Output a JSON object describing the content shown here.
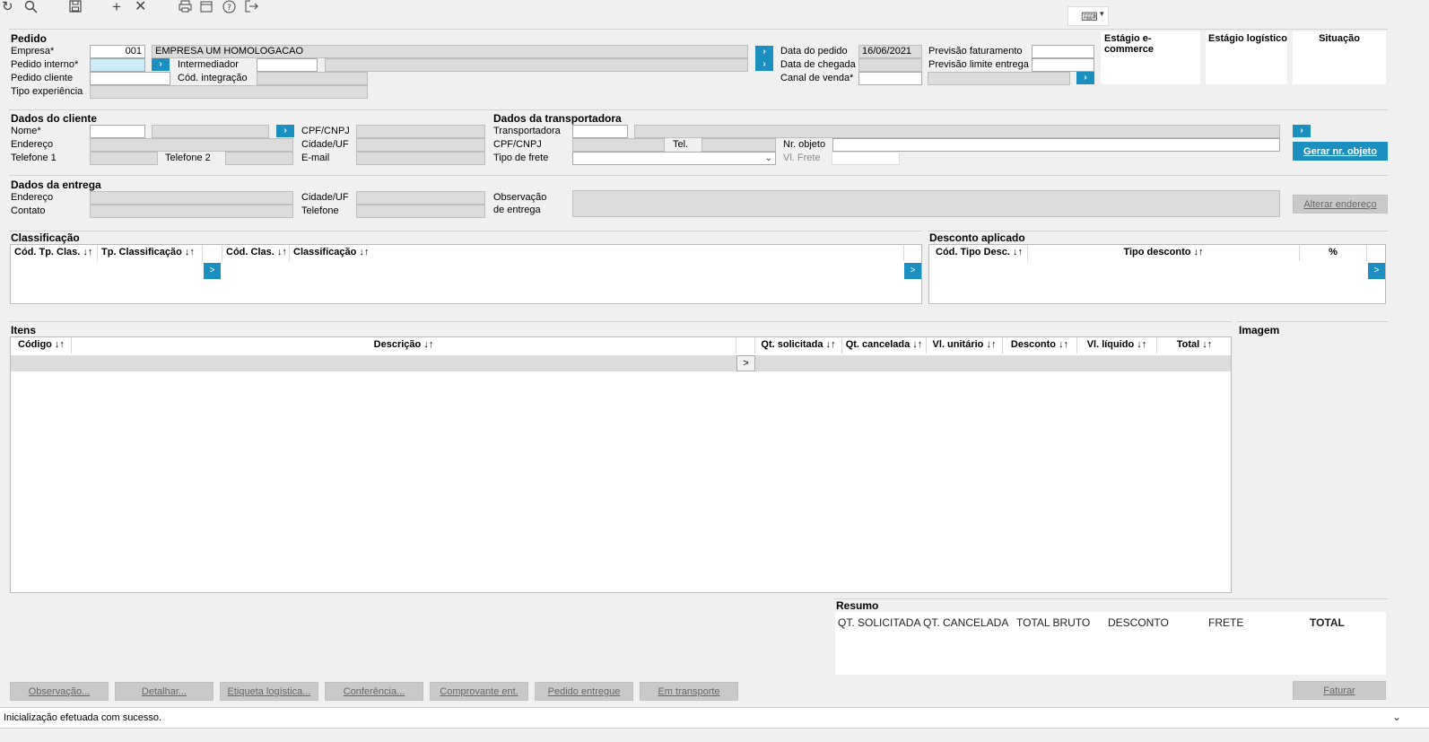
{
  "toolbar": {
    "icons": [
      "refresh-icon",
      "search-icon",
      "save-icon",
      "add-icon",
      "close-icon",
      "print-icon",
      "calendar-icon",
      "help-icon",
      "exit-icon"
    ],
    "keyboard_icon": "keyboard-icon"
  },
  "pedido": {
    "title": "Pedido",
    "empresa_label": "Empresa*",
    "empresa_code": "001",
    "empresa_name": "EMPRESA UM HOMOLOGACAO",
    "pedido_interno_label": "Pedido interno*",
    "pedido_interno_value": "",
    "intermediador_label": "Intermediador",
    "cod_integracao_label": "Cód. integração",
    "pedido_cliente_label": "Pedido cliente",
    "tipo_experiencia_label": "Tipo experiência",
    "data_pedido_label": "Data do pedido",
    "data_pedido_value": "16/06/2021",
    "data_chegada_label": "Data de chegada",
    "canal_venda_label": "Canal de venda*",
    "previsao_faturamento_label": "Previsão faturamento",
    "previsao_limite_label": "Previsão limite entrega",
    "estagio_ecommerce": "Estágio e-commerce",
    "estagio_logistico": "Estágio logístico",
    "situacao": "Situação"
  },
  "cliente": {
    "title": "Dados do cliente",
    "nome_label": "Nome*",
    "endereco_label": "Endereço",
    "telefone1_label": "Telefone 1",
    "telefone2_label": "Telefone 2",
    "cpf_label": "CPF/CNPJ",
    "cidade_label": "Cidade/UF",
    "email_label": "E-mail"
  },
  "transportadora": {
    "title": "Dados da transportadora",
    "transportadora_label": "Transportadora",
    "cpf_label": "CPF/CNPJ",
    "tel_label": "Tel.",
    "tipo_frete_label": "Tipo de frete",
    "nr_objeto_label": "Nr. objeto",
    "vl_frete_label": "Vl. Frete",
    "gerar_button": "Gerar nr. objeto"
  },
  "entrega": {
    "title": "Dados da entrega",
    "endereco_label": "Endereço",
    "contato_label": "Contato",
    "cidade_label": "Cidade/UF",
    "telefone_label": "Telefone",
    "obs_label_1": "Observação",
    "obs_label_2": "de entrega",
    "alterar_button": "Alterar endereço"
  },
  "classificacao": {
    "title": "Classificação",
    "columns": [
      "Cód. Tp. Clas. ↓↑",
      "Tp. Classificação ↓↑",
      "Cód. Clas. ↓↑",
      "Classificação ↓↑"
    ],
    "arrow": ">"
  },
  "desconto": {
    "title": "Desconto aplicado",
    "columns": [
      "Cód. Tipo Desc. ↓↑",
      "Tipo desconto ↓↑",
      "%"
    ],
    "arrow": ">"
  },
  "itens": {
    "title": "Itens",
    "columns": [
      "Código ↓↑",
      "Descrição ↓↑",
      "Qt. solicitada ↓↑",
      "Qt. cancelada ↓↑",
      "Vl. unitário ↓↑",
      "Desconto ↓↑",
      "Vl. líquido ↓↑",
      "Total ↓↑"
    ],
    "row_arrow": ">"
  },
  "imagem": {
    "title": "Imagem"
  },
  "resumo": {
    "title": "Resumo",
    "columns": [
      "QT. SOLICITADA",
      "QT. CANCELADA",
      "TOTAL BRUTO",
      "DESCONTO",
      "FRETE",
      "TOTAL"
    ]
  },
  "buttons": {
    "observacao": "Observação...",
    "detalhar": "Detalhar...",
    "etiqueta": "Etiqueta logística...",
    "conferencia": "Conferência...",
    "comprovante": "Comprovante ent.",
    "pedido_entregue": "Pedido entregue",
    "em_transporte": "Em transporte",
    "faturar": "Faturar"
  },
  "status": {
    "message": "Inicialização efetuada com sucesso."
  }
}
